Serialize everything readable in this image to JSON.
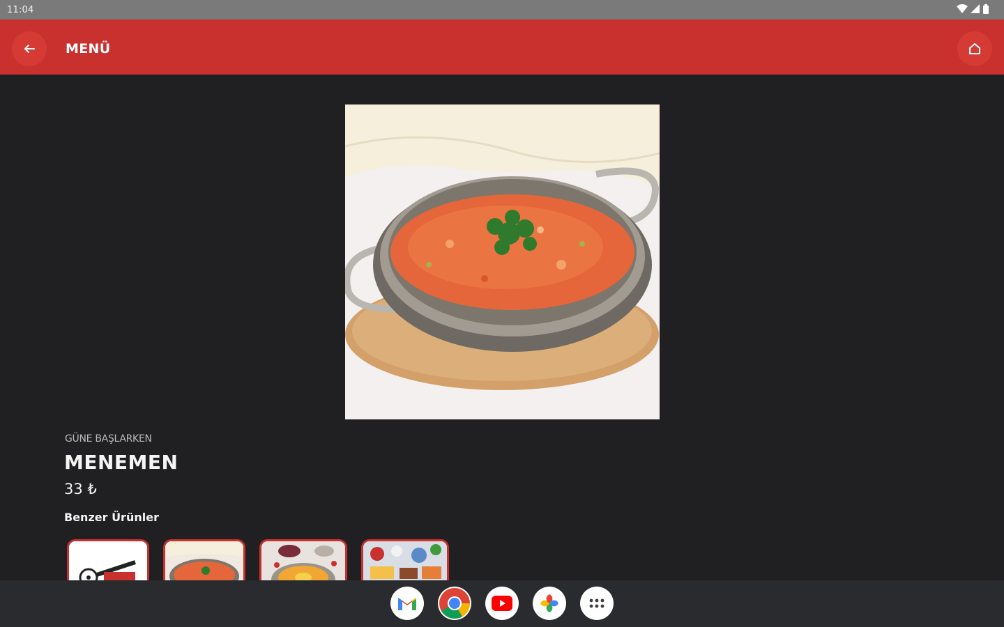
{
  "status_bar": {
    "time": "11:04"
  },
  "app_bar": {
    "title": "MENÜ",
    "back_icon": "arrow-left-icon",
    "home_icon": "home-icon",
    "color": "#c8312d"
  },
  "product": {
    "category": "GÜNE BAŞLARKEN",
    "name": "MENEMEN",
    "price": "33 ₺",
    "image": "menemen-dish-photo"
  },
  "similar": {
    "title": "Benzer Ürünler",
    "items": [
      {
        "image": "film-logo-thumbnail"
      },
      {
        "image": "menemen-thumbnail"
      },
      {
        "image": "breakfast-bowl-thumbnail"
      },
      {
        "image": "breakfast-spread-thumbnail"
      }
    ]
  },
  "dock": {
    "apps": [
      "gmail-icon",
      "chrome-icon",
      "youtube-icon",
      "photos-icon",
      "app-drawer-icon"
    ]
  }
}
